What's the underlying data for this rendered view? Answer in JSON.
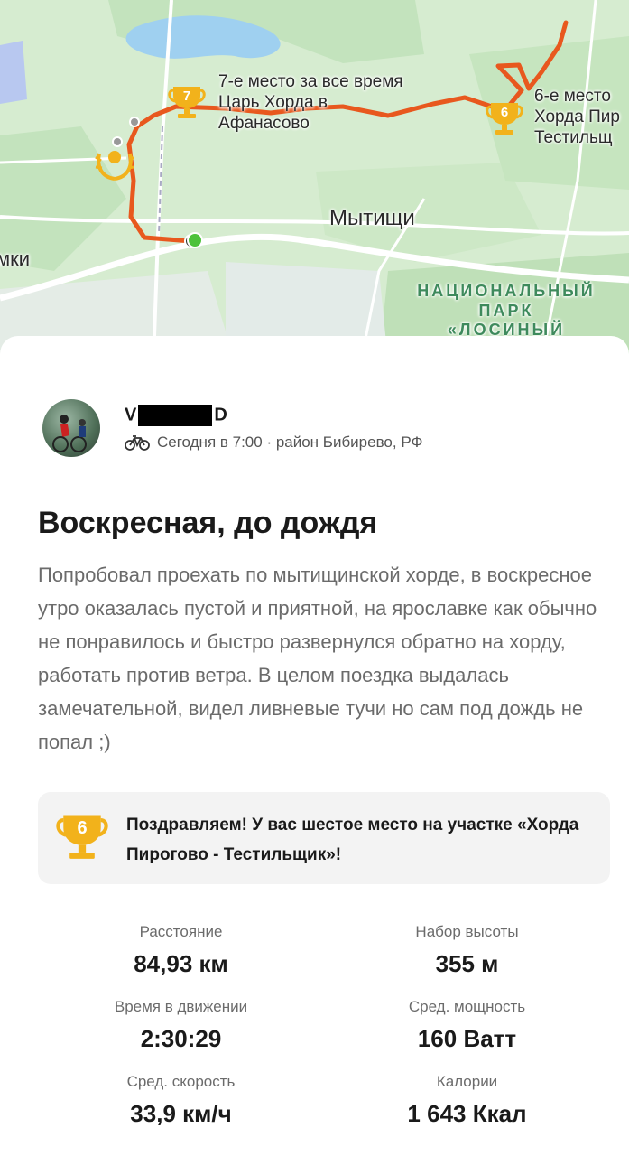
{
  "map": {
    "segment_7": {
      "rank": "7",
      "text": "7-е место за все время\nЦарь Хорда в\nАфанасово"
    },
    "segment_6": {
      "rank": "6",
      "text": "6-е место\nХорда Пир\nТестильщ"
    },
    "city": "Мытищи",
    "city_left": "мки",
    "park": "НАЦИОНАЛЬНЫЙ\nПАРК\n«ЛОСИНЫЙ",
    "route_color": "#e8581e",
    "trophy_color": "#f2b21b"
  },
  "activity": {
    "user_prefix": "V",
    "user_suffix": "D",
    "meta": "Сегодня в 7:00 · район Бибирево, РФ",
    "title": "Воскресная, до дождя",
    "description": "Попробовал проехать по мытищинской хорде, в воскресное утро оказалась пустой и приятной, на ярославке как обычно не понравилось и быстро развернулся обратно на хорду, работать против ветра. В целом поездка выдалась замечательной, видел ливневые тучи но сам под дождь не попал ;)"
  },
  "achievement": {
    "rank": "6",
    "text": "Поздравляем! У вас шестое место на участке «Хорда Пирогово - Тестильщик»!"
  },
  "stats": [
    {
      "label": "Расстояние",
      "value": "84,93 км"
    },
    {
      "label": "Набор высоты",
      "value": "355 м"
    },
    {
      "label": "Время в движении",
      "value": "2:30:29"
    },
    {
      "label": "Сред. мощность",
      "value": "160 Ватт"
    },
    {
      "label": "Сред. скорость",
      "value": "33,9 км/ч"
    },
    {
      "label": "Калории",
      "value": "1 643 Ккал"
    }
  ]
}
